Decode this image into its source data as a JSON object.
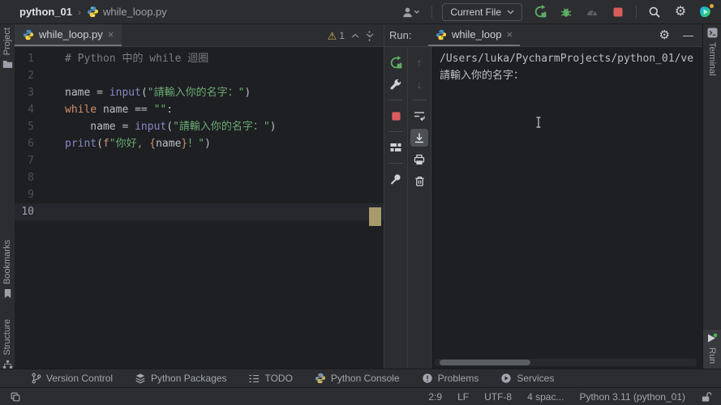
{
  "title_bar": {
    "project": "python_01",
    "separator": "›",
    "file": "while_loop.py",
    "run_config": "Current File"
  },
  "icons": {
    "gear": "⚙",
    "kebab": "⋮",
    "close": "×",
    "warning": "⚠",
    "arrow_up": "↑",
    "arrow_down": "↓",
    "minimize": "—"
  },
  "stripes": {
    "left": [
      {
        "label": "Project"
      },
      {
        "label": "Bookmarks"
      },
      {
        "label": "Structure"
      }
    ],
    "right": {
      "terminal": "Terminal",
      "run": "Run"
    }
  },
  "editor": {
    "tab": "while_loop.py",
    "inspection": {
      "warning_count": "1"
    },
    "lines": [
      {
        "num": "1",
        "tokens": [
          {
            "t": "# Python 中的 while 迴圈"
          }
        ]
      },
      {
        "num": "2",
        "tokens": []
      },
      {
        "num": "3",
        "tokens": [
          {
            "t": "name = "
          },
          {
            "t": "input"
          },
          {
            "t": "("
          },
          {
            "t": "\"請輸入你的名字：\""
          },
          {
            "t": ")"
          }
        ]
      },
      {
        "num": "4",
        "tokens": [
          {
            "t": "while"
          },
          {
            "t": " name == "
          },
          {
            "t": "\"\""
          },
          {
            "t": ":"
          }
        ]
      },
      {
        "num": "5",
        "tokens": [
          {
            "t": "    name = "
          },
          {
            "t": "input"
          },
          {
            "t": "("
          },
          {
            "t": "\"請輸入你的名字：\""
          },
          {
            "t": ")"
          }
        ]
      },
      {
        "num": "6",
        "tokens": [
          {
            "t": "print"
          },
          {
            "t": "("
          },
          {
            "t": "f"
          },
          {
            "t": "\"你好, "
          },
          {
            "t": "{"
          },
          {
            "t": "name"
          },
          {
            "t": "}"
          },
          {
            "t": "！\""
          },
          {
            "t": ")"
          }
        ]
      },
      {
        "num": "7",
        "tokens": []
      },
      {
        "num": "8",
        "tokens": []
      },
      {
        "num": "9",
        "tokens": []
      },
      {
        "num": "10",
        "tokens": []
      }
    ]
  },
  "run": {
    "label": "Run:",
    "tab": "while_loop",
    "console": {
      "line1": "/Users/luka/PycharmProjects/python_01/ve",
      "line2": "請輸入你的名字："
    }
  },
  "toolwindow_bar": {
    "items": [
      {
        "label": "Version Control"
      },
      {
        "label": "Python Packages"
      },
      {
        "label": "TODO"
      },
      {
        "label": "Python Console"
      },
      {
        "label": "Problems"
      },
      {
        "label": "Services"
      }
    ]
  },
  "status_bar": {
    "caret": "2:9",
    "line_separator": "LF",
    "encoding": "UTF-8",
    "indent": "4 spac...",
    "interpreter": "Python 3.11 (python_01)"
  },
  "colors": {
    "run_green": "#5FAD65",
    "stop_red": "#DB5C5C",
    "string_green": "#6AAB73",
    "keyword_orange": "#CF8E6D",
    "builtin_purple": "#8888C6",
    "comment_gray": "#7A7E85",
    "caret_block_tan": "#A79B6B",
    "panel_bg": "#2B2D30",
    "editor_bg": "#1E1F22"
  }
}
